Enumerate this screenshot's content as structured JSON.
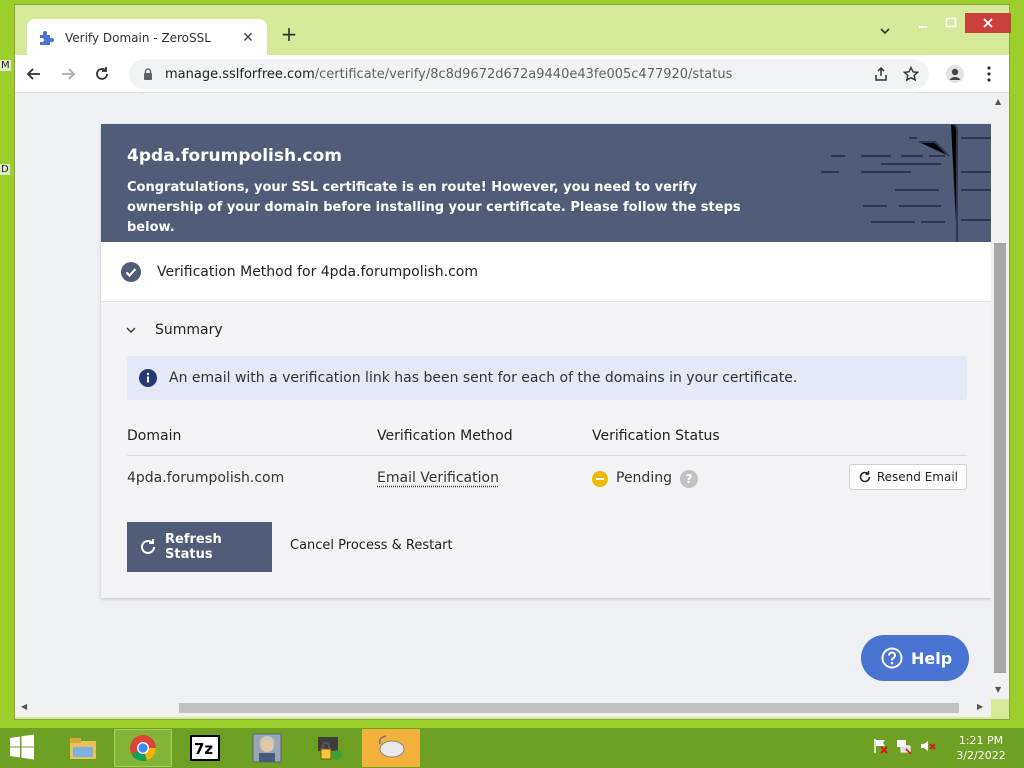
{
  "browser": {
    "tab_title": "Verify Domain - ZeroSSL",
    "new_tab_label": "+",
    "url_host": "manage.sslforfree.com",
    "url_path": "/certificate/verify/8c8d9672d672a9440e43fe005c477920/status"
  },
  "hero": {
    "domain": "4pda.forumpolish.com",
    "message": "Congratulations, your SSL certificate is en route! However, you need to verify ownership of your domain before installing your certificate. Please follow the steps below."
  },
  "method_row": {
    "label": "Verification Method for 4pda.forumpolish.com"
  },
  "summary": {
    "label": "Summary",
    "notice": "An email with a verification link has been sent for each of the domains in your certificate."
  },
  "table": {
    "headers": [
      "Domain",
      "Verification Method",
      "Verification Status"
    ],
    "rows": [
      {
        "domain": "4pda.forumpolish.com",
        "method": "Email Verification",
        "status": "Pending",
        "action": "Resend Email"
      }
    ]
  },
  "actions": {
    "refresh": "Refresh Status",
    "cancel": "Cancel Process & Restart"
  },
  "help": {
    "label": "Help"
  },
  "taskbar": {
    "time": "1:21 PM",
    "date": "3/2/2022"
  },
  "colors": {
    "hero_bg": "#515c79",
    "accent_blue": "#4a74d4",
    "pending": "#f0b800",
    "desktop": "#9ccf2c"
  },
  "desktop_glyphs": [
    "M",
    "D"
  ]
}
